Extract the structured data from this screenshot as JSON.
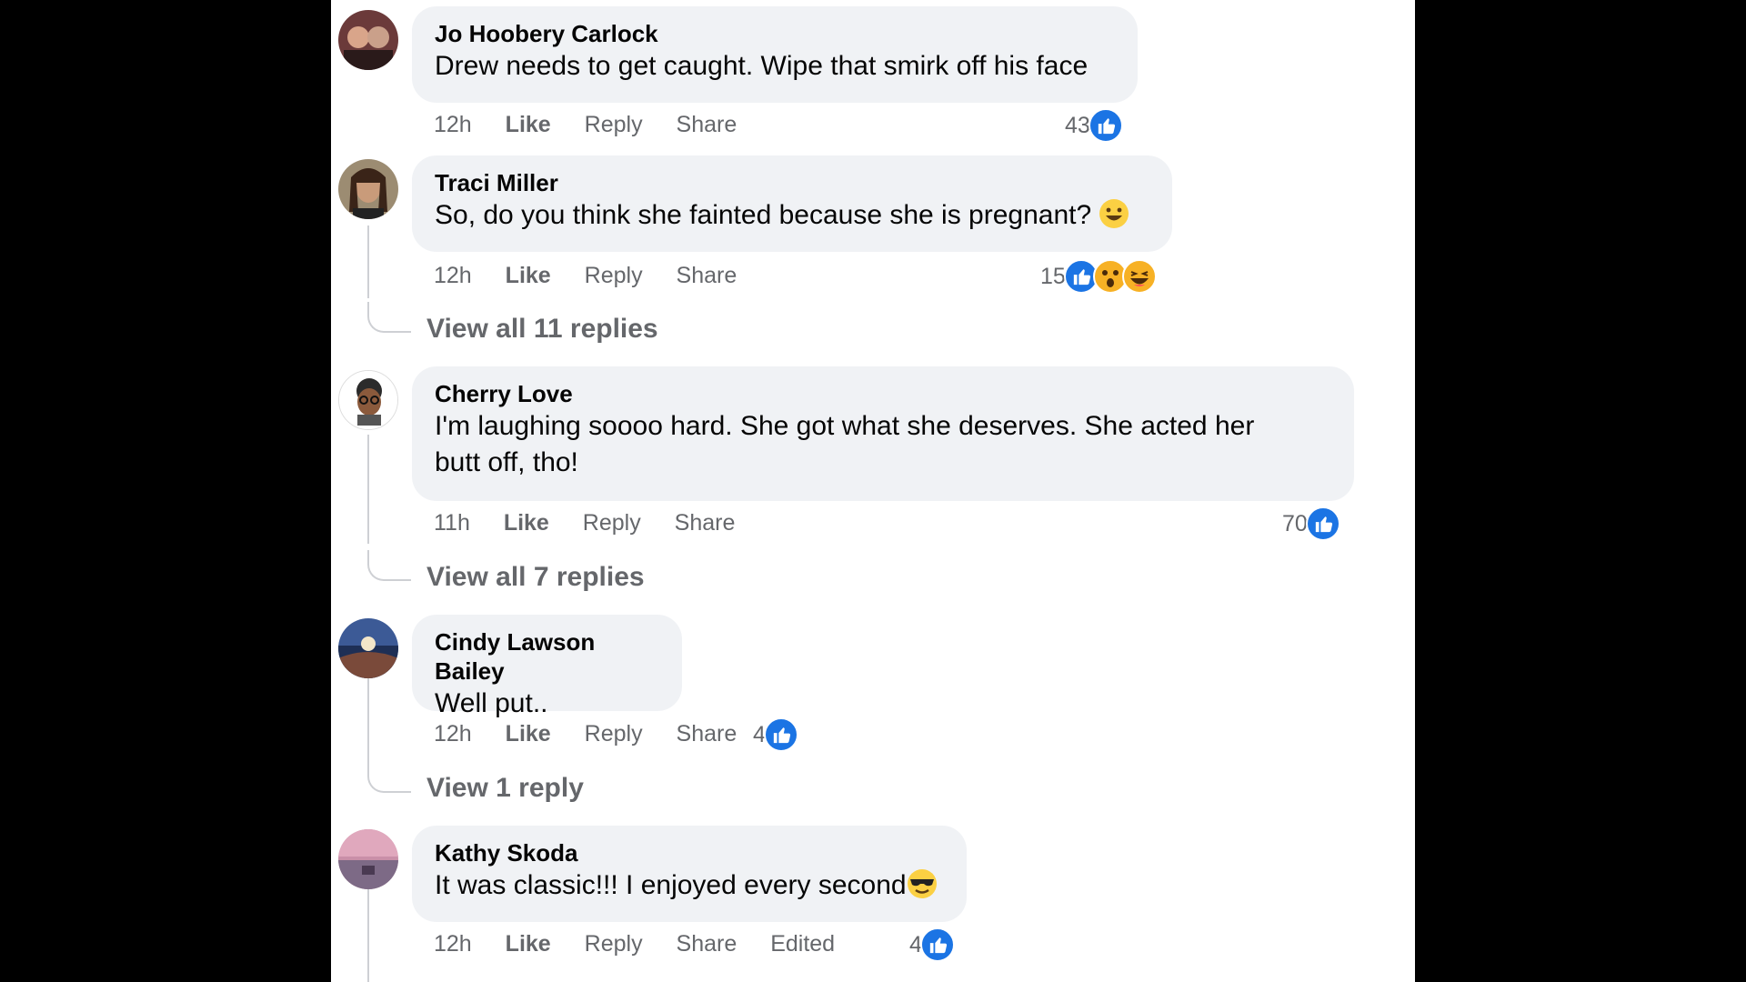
{
  "comments": [
    {
      "author": "Jo Hoobery Carlock",
      "text": "Drew needs to get caught. Wipe that smirk off his face",
      "time": "12h",
      "like": "Like",
      "reply": "Reply",
      "share": "Share",
      "reaction_count": "43",
      "reactions": [
        "like-icon"
      ]
    },
    {
      "author": "Traci Miller",
      "text": "So, do you think she fainted because she is pregnant?",
      "emoji": "smiley-emoji",
      "time": "12h",
      "like": "Like",
      "reply": "Reply",
      "share": "Share",
      "reaction_count": "15",
      "reactions": [
        "like-icon",
        "wow-icon",
        "haha-icon"
      ],
      "view_replies": "View all 11 replies"
    },
    {
      "author": "Cherry Love",
      "text_line1": "I'm laughing soooo hard. She got what she deserves. She acted her",
      "text_line2": "butt off, tho!",
      "time": "11h",
      "like": "Like",
      "reply": "Reply",
      "share": "Share",
      "reaction_count": "70",
      "reactions": [
        "like-icon"
      ],
      "view_replies": "View all 7 replies"
    },
    {
      "author": "Cindy Lawson Bailey",
      "text": "Well put..",
      "time": "12h",
      "like": "Like",
      "reply": "Reply",
      "share": "Share",
      "reaction_count": "4",
      "reactions": [
        "like-icon"
      ],
      "view_replies": "View 1 reply"
    },
    {
      "author": "Kathy Skoda",
      "text": "It was classic!!! I enjoyed every second",
      "emoji": "sunglasses-emoji",
      "time": "12h",
      "like": "Like",
      "reply": "Reply",
      "share": "Share",
      "edited": "Edited",
      "reaction_count": "4",
      "reactions": [
        "like-icon"
      ]
    }
  ],
  "colors": {
    "background": "#000000",
    "panel": "#ffffff",
    "bubble": "#f0f2f5",
    "meta_text": "#65676b",
    "like_blue": "#1b74e4",
    "emoji_yellow": "#f7b125"
  }
}
